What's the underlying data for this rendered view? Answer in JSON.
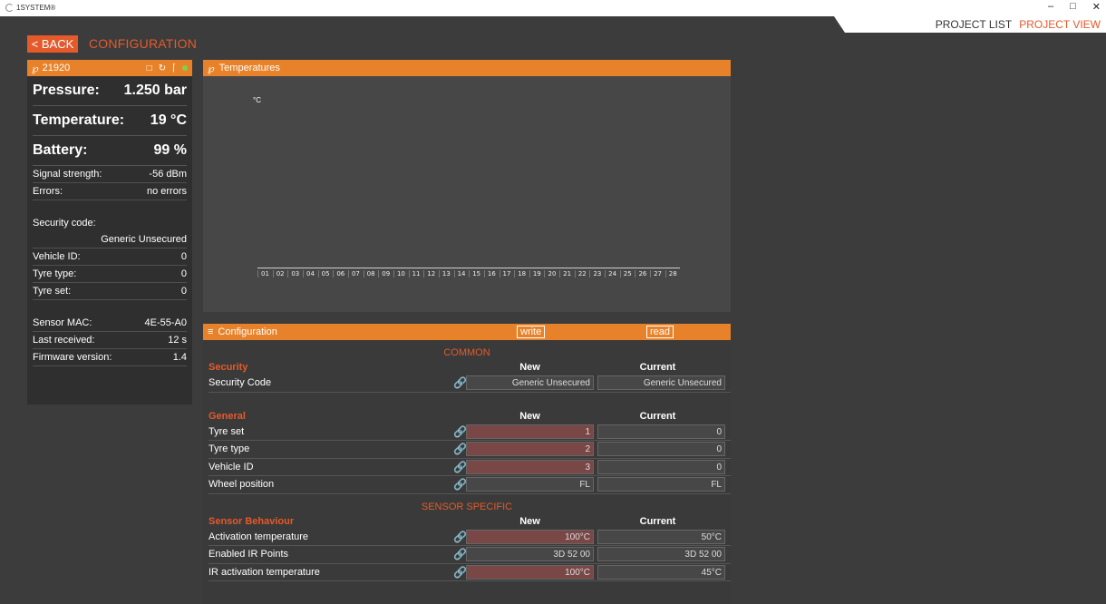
{
  "app": {
    "title": "1SYSTEM®"
  },
  "window": {
    "minimize": "–",
    "restore": "□",
    "close": "✕"
  },
  "nav": {
    "project_list": "PROJECT LIST",
    "project_view": "PROJECT VIEW"
  },
  "header": {
    "back": "< BACK",
    "title": "CONFIGURATION"
  },
  "sensor": {
    "id": "21920",
    "status_color": "#7fd14c",
    "pressure": {
      "label": "Pressure:",
      "value": "1.250 bar"
    },
    "temperature": {
      "label": "Temperature:",
      "value": "19 °C"
    },
    "battery": {
      "label": "Battery:",
      "value": "99 %"
    },
    "signal": {
      "label": "Signal strength:",
      "value": "-56 dBm"
    },
    "errors": {
      "label": "Errors:",
      "value": "no errors"
    },
    "security": {
      "label": "Security code:",
      "value": "Generic Unsecured"
    },
    "vehicle_id": {
      "label": "Vehicle ID:",
      "value": "0"
    },
    "tyre_type": {
      "label": "Tyre type:",
      "value": "0"
    },
    "tyre_set": {
      "label": "Tyre set:",
      "value": "0"
    },
    "mac": {
      "label": "Sensor MAC:",
      "value": "4E-55-A0"
    },
    "last_received": {
      "label": "Last received:",
      "value": "12 s"
    },
    "firmware": {
      "label": "Firmware version:",
      "value": "1.4"
    }
  },
  "temperatures": {
    "title": "Temperatures",
    "unit": "°C",
    "ticks": [
      "01",
      "02",
      "03",
      "04",
      "05",
      "06",
      "07",
      "08",
      "09",
      "10",
      "11",
      "12",
      "13",
      "14",
      "15",
      "16",
      "17",
      "18",
      "19",
      "20",
      "21",
      "22",
      "23",
      "24",
      "25",
      "26",
      "27",
      "28"
    ]
  },
  "configuration": {
    "title": "Configuration",
    "write": "write",
    "read": "read",
    "common": "COMMON",
    "sensor_specific": "SENSOR SPECIFIC",
    "col_new": "New",
    "col_current": "Current",
    "security": {
      "title": "Security",
      "rows": [
        {
          "label": "Security Code",
          "new": "Generic Unsecured",
          "current": "Generic Unsecured"
        }
      ]
    },
    "general": {
      "title": "General",
      "rows": [
        {
          "label": "Tyre set",
          "new": "1",
          "current": "0"
        },
        {
          "label": "Tyre type",
          "new": "2",
          "current": "0"
        },
        {
          "label": "Vehicle ID",
          "new": "3",
          "current": "0"
        },
        {
          "label": "Wheel position",
          "new": "FL",
          "current": "FL"
        }
      ]
    },
    "behaviour": {
      "title": "Sensor Behaviour",
      "rows": [
        {
          "label": "Activation temperature",
          "new": "100°C",
          "current": "50°C"
        },
        {
          "label": "Enabled IR Points",
          "new": "3D 52 00",
          "current": "3D 52 00"
        },
        {
          "label": "IR activation temperature",
          "new": "100°C",
          "current": "45°C"
        }
      ]
    }
  }
}
